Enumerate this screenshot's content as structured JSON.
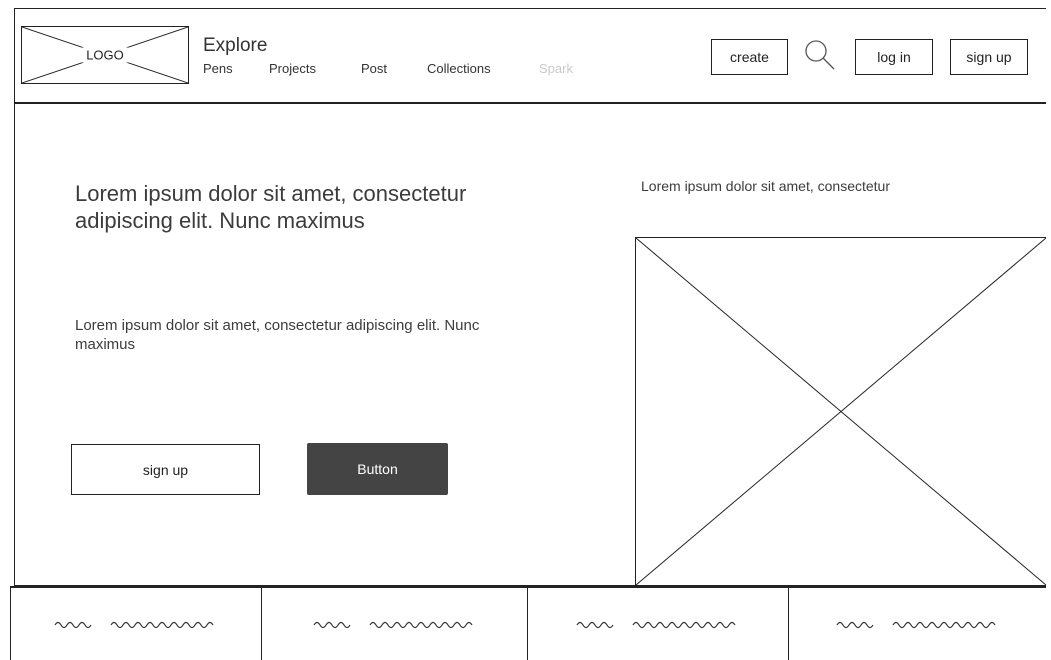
{
  "header": {
    "logo_text": "LOGO",
    "explore_title": "Explore",
    "nav": [
      {
        "label": "Pens"
      },
      {
        "label": "Projects"
      },
      {
        "label": "Post"
      },
      {
        "label": "Collections"
      },
      {
        "label": "Spark"
      }
    ],
    "create_label": "create",
    "login_label": "log in",
    "signup_label": "sign up"
  },
  "hero": {
    "title": "Lorem ipsum dolor sit amet, consectetur adipiscing elit. Nunc maximus",
    "subtitle": "Lorem ipsum dolor sit amet, consectetur adipiscing elit. Nunc maximus",
    "signup_label": "sign up",
    "button_label": "Button"
  },
  "side": {
    "caption": "Lorem ipsum dolor sit amet, consectetur"
  },
  "icons": {
    "logo": "logo-placeholder-icon",
    "search": "search-icon",
    "image": "image-placeholder-icon"
  },
  "colors": {
    "primary_button": "#444444",
    "disabled_text": "#c9c9c9",
    "stroke": "#222222"
  }
}
